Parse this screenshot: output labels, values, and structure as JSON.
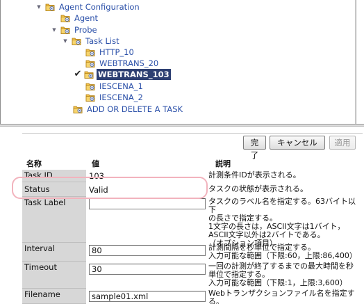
{
  "tree": {
    "items": [
      {
        "label": "Agent Configuration",
        "level": 0,
        "toggle": "expanded"
      },
      {
        "label": "Agent",
        "level": 1
      },
      {
        "label": "Probe",
        "level": 1,
        "toggle": "expanded"
      },
      {
        "label": "Task List",
        "level": 2,
        "toggle": "expanded"
      },
      {
        "label": "HTTP_10",
        "level": 3
      },
      {
        "label": "WEBTRANS_20",
        "level": 3
      },
      {
        "label": "WEBTRANS_103",
        "level": 3,
        "selected": true,
        "checked": true
      },
      {
        "label": "IESCENA_1",
        "level": 3
      },
      {
        "label": "IESCENA_2",
        "level": 3
      },
      {
        "label": "ADD OR DELETE A TASK",
        "level": 2
      }
    ]
  },
  "toolbar": {
    "ok_label": "完了",
    "cancel_label": "キャンセル",
    "apply_label": "適用"
  },
  "grid": {
    "headers": {
      "name": "名称",
      "value": "値",
      "desc": "説明"
    },
    "rows": {
      "task_id": {
        "name": "Task ID",
        "value": "103",
        "desc": "計測条件IDが表示される。"
      },
      "status": {
        "name": "Status",
        "value": "Valid",
        "desc": "タスクの状態が表示される。"
      },
      "task_label": {
        "name": "Task Label",
        "value": "",
        "desc": "タスクのラベル名を指定する。63バイト以下\nの長さで指定する。\n1文字の長さは，ASCII文字は1バイト，\nASCII文字以外は2バイトである。\n（オプション項目）"
      },
      "interval": {
        "name": "Interval",
        "value": "80",
        "desc": "計測間隔を秒単位で指定する。\n入力可能な範囲（下限:60，上限:86,400）"
      },
      "timeout": {
        "name": "Timeout",
        "value": "30",
        "desc": "一回の計測が終了するまでの最大時間を秒\n単位で指定する。\n入力可能な範囲（下限:1，上限:3,600）"
      },
      "filename": {
        "name": "Filename",
        "value": "sample01.xml",
        "desc": "Webトランザクションファイル名を指定する。"
      }
    }
  },
  "colors": {
    "link": "#2a4fa8",
    "selected_bg": "#2d3f72",
    "highlight": "#f2b3bd",
    "name_cell_bg": "#d7d7d7"
  }
}
